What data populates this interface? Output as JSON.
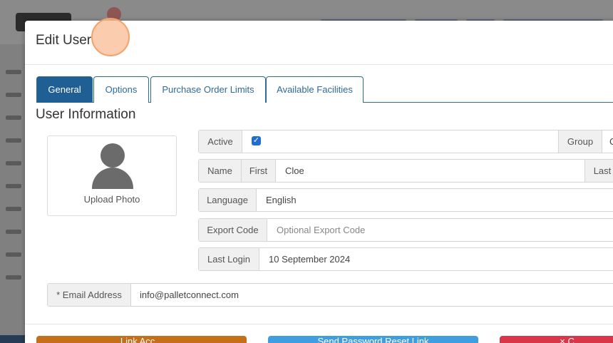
{
  "modal": {
    "title": "Edit User",
    "tabs": [
      "General",
      "Options",
      "Purchase Order Limits",
      "Available Facilities"
    ],
    "active_tab": "General",
    "section_title": "User Information"
  },
  "photo": {
    "label": "Upload Photo",
    "icon": "user-avatar-icon"
  },
  "form": {
    "active_label": "Active",
    "active_checked": true,
    "group_label": "Group",
    "group_value": "C",
    "name_label": "Name",
    "first_label": "First",
    "first_value": "Cloe",
    "last_label": "Last",
    "language_label": "Language",
    "language_value": "English",
    "export_code_label": "Export Code",
    "export_code_placeholder": "Optional Export Code",
    "last_login_label": "Last Login",
    "last_login_value": "10 September 2024",
    "email_label": "* Email Address",
    "email_value": "info@palletconnect.com"
  },
  "buttons": {
    "link_label": "Link Acc...",
    "reset_label": "Send Password Reset Link",
    "close_label": "× C..."
  },
  "colors": {
    "primary": "#1f5f93",
    "orange": "#c66f1a",
    "blue": "#3f9ee0",
    "red": "#d9364a"
  }
}
